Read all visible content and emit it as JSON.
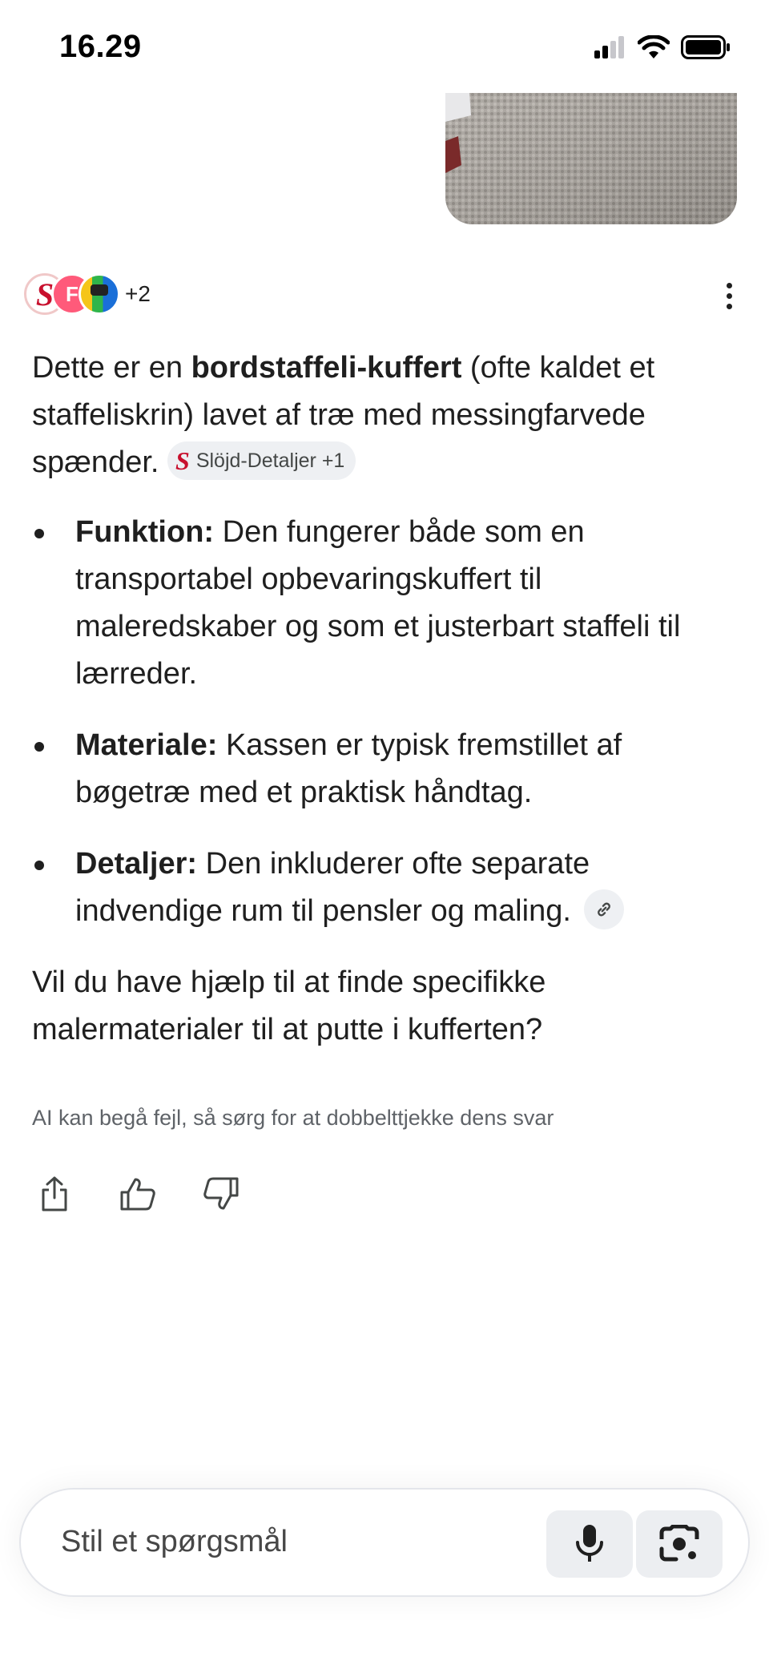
{
  "status_bar": {
    "time": "16.29"
  },
  "sources": {
    "count_label": "+2",
    "avatar_1_letter": "S",
    "avatar_2_letter": "F"
  },
  "answer": {
    "intro_pre": "Dette er en ",
    "intro_bold": "bordstaffeli-kuffert",
    "intro_post": " (ofte kaldet et staffeliskrin) lavet af træ med messingfarvede spænder.",
    "source_chip": {
      "logo": "S",
      "label": "Slöjd-Detaljer +1"
    },
    "bullets": [
      {
        "term": "Funktion:",
        "text": " Den fungerer både som en transportabel opbevaringskuffert til maleredskaber og som et justerbart staffeli til lærreder."
      },
      {
        "term": "Materiale:",
        "text": " Kassen er typisk fremstillet af bøgetræ med et praktisk håndtag."
      },
      {
        "term": "Detaljer:",
        "text": " Den inkluderer ofte separate indvendige rum til pensler og maling."
      }
    ],
    "followup": "Vil du have hjælp til at finde specifikke malermaterialer til at putte i kufferten?"
  },
  "disclaimer": "AI kan begå fejl, så sørg for at dobbelttjekke dens svar",
  "input": {
    "placeholder": "Stil et spørgsmål"
  },
  "icons": [
    "signal-icon",
    "wifi-icon",
    "battery-icon",
    "more-vert-icon",
    "link-icon",
    "share-icon",
    "thumbs-up-icon",
    "thumbs-down-icon",
    "mic-icon",
    "lens-icon"
  ]
}
